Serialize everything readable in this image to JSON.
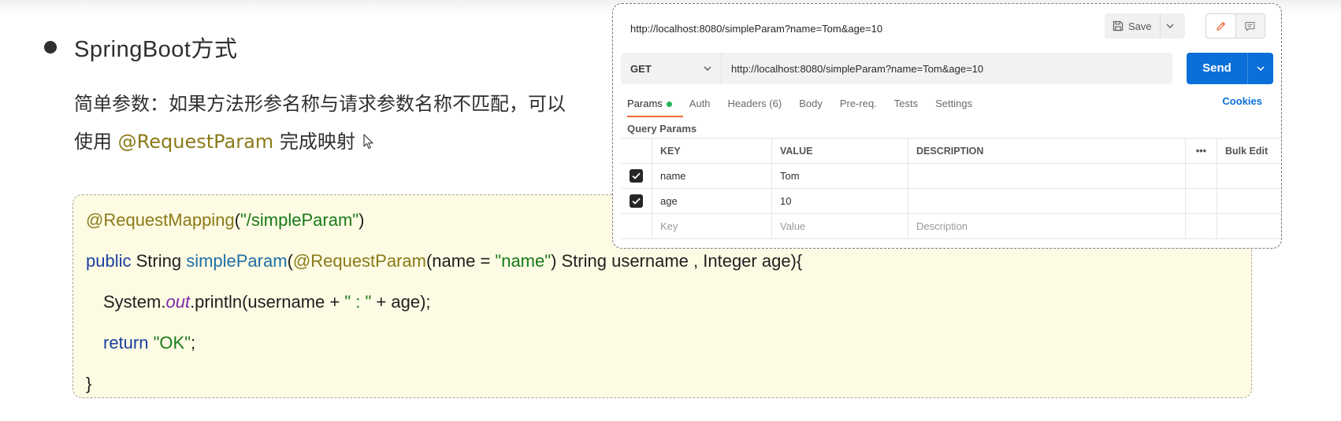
{
  "slide": {
    "bullet_title": "SpringBoot方式",
    "desc_line1": "简单参数：如果方法形参名称与请求参数名称不匹配，可以",
    "desc_line2_prefix": "使用 ",
    "desc_line2_annotation": "@RequestParam",
    "desc_line2_suffix": " 完成映射"
  },
  "code": {
    "line1": {
      "annotation": "@RequestMapping",
      "open": "(",
      "string": "\"/simpleParam\"",
      "close": ")"
    },
    "line2": {
      "keyword": "public",
      "type": " String ",
      "method": "simpleParam",
      "open": "(",
      "annotation": "@RequestParam",
      "args_open": "(name = ",
      "string": "\"name\"",
      "rest": ") String username , Integer age){"
    },
    "line3": {
      "class": "System.",
      "static_field": "out",
      "call": ".println(username + ",
      "string": "\" : \"",
      "rest": " + age);"
    },
    "line4": {
      "keyword": "return",
      "space": " ",
      "string": "\"OK\"",
      "semicolon": ";"
    },
    "line5": {
      "brace": "}"
    }
  },
  "postman": {
    "url_title": "http://localhost:8080/simpleParam?name=Tom&age=10",
    "save_label": "Save",
    "method": "GET",
    "url": "http://localhost:8080/simpleParam?name=Tom&age=10",
    "send_label": "Send",
    "tabs": [
      {
        "label": "Params"
      },
      {
        "label": "Auth"
      },
      {
        "label": "Headers (6)"
      },
      {
        "label": "Body"
      },
      {
        "label": "Pre-req."
      },
      {
        "label": "Tests"
      },
      {
        "label": "Settings"
      }
    ],
    "cookies_label": "Cookies",
    "section_label": "Query Params",
    "table": {
      "headers": {
        "key": "KEY",
        "value": "VALUE",
        "description": "DESCRIPTION",
        "more": "•••",
        "bulk_edit": "Bulk Edit"
      },
      "rows": [
        {
          "key": "name",
          "value": "Tom",
          "description": "",
          "checked": true
        },
        {
          "key": "age",
          "value": "10",
          "description": "",
          "checked": true
        }
      ],
      "placeholder": {
        "key": "Key",
        "value": "Value",
        "description": "Description"
      }
    }
  }
}
